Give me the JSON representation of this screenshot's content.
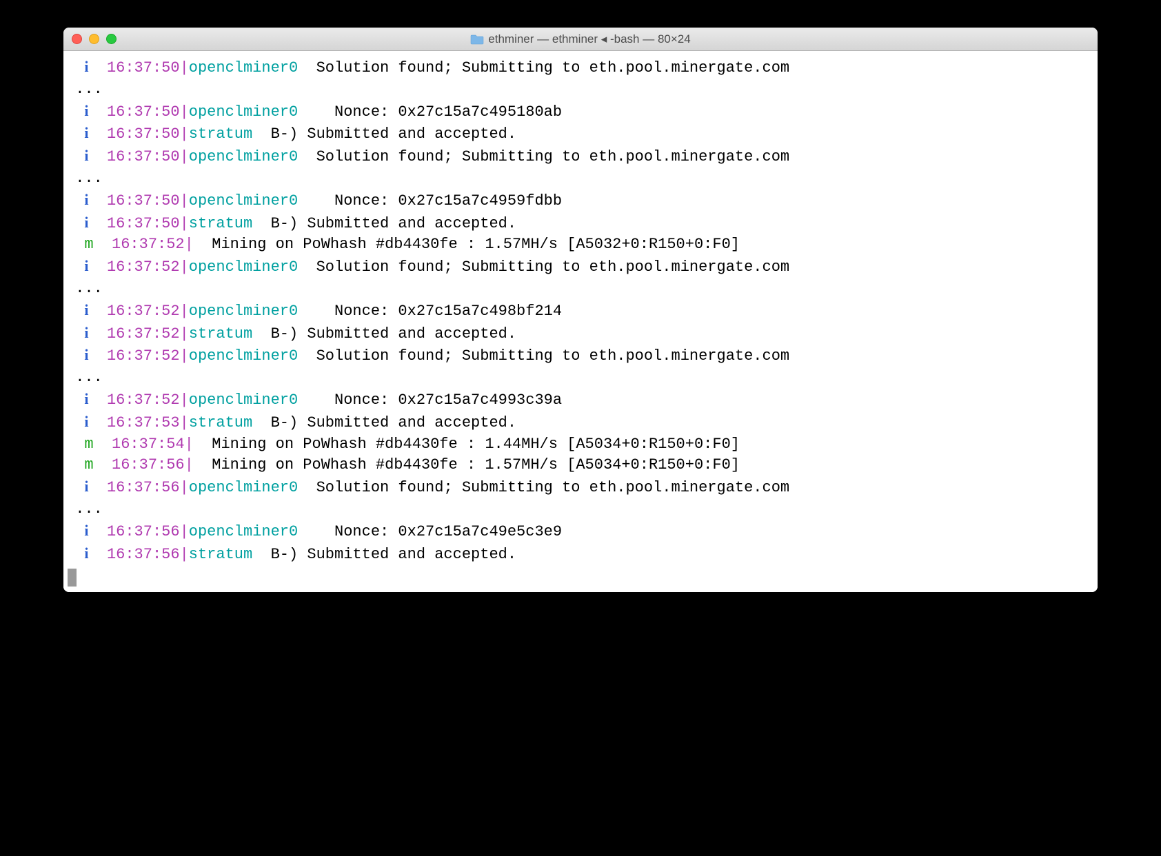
{
  "window": {
    "title": "ethminer — ethminer ◂ -bash — 80×24"
  },
  "colors": {
    "info_level": "#2b5dcd",
    "mining_level": "#1fa61f",
    "timestamp": "#b03ab0",
    "source": "#00a0a0",
    "text": "#000000"
  },
  "lines": [
    {
      "type": "log",
      "level": "i",
      "ts": "16:37:50",
      "src": "openclminer0",
      "msg": "  Solution found; Submitting to eth.pool.minergate.com"
    },
    {
      "type": "ellipsis",
      "text": " ..."
    },
    {
      "type": "log",
      "level": "i",
      "ts": "16:37:50",
      "src": "openclminer0",
      "msg": "    Nonce: 0x27c15a7c495180ab"
    },
    {
      "type": "log",
      "level": "i",
      "ts": "16:37:50",
      "src": "stratum",
      "msg": "  B-) Submitted and accepted."
    },
    {
      "type": "log",
      "level": "i",
      "ts": "16:37:50",
      "src": "openclminer0",
      "msg": "  Solution found; Submitting to eth.pool.minergate.com"
    },
    {
      "type": "ellipsis",
      "text": " ..."
    },
    {
      "type": "log",
      "level": "i",
      "ts": "16:37:50",
      "src": "openclminer0",
      "msg": "    Nonce: 0x27c15a7c4959fdbb"
    },
    {
      "type": "log",
      "level": "i",
      "ts": "16:37:50",
      "src": "stratum",
      "msg": "  B-) Submitted and accepted."
    },
    {
      "type": "log",
      "level": "m",
      "ts": "16:37:52",
      "src": "",
      "msg": "  Mining on PoWhash #db4430fe : 1.57MH/s [A5032+0:R150+0:F0]"
    },
    {
      "type": "log",
      "level": "i",
      "ts": "16:37:52",
      "src": "openclminer0",
      "msg": "  Solution found; Submitting to eth.pool.minergate.com"
    },
    {
      "type": "ellipsis",
      "text": " ..."
    },
    {
      "type": "log",
      "level": "i",
      "ts": "16:37:52",
      "src": "openclminer0",
      "msg": "    Nonce: 0x27c15a7c498bf214"
    },
    {
      "type": "log",
      "level": "i",
      "ts": "16:37:52",
      "src": "stratum",
      "msg": "  B-) Submitted and accepted."
    },
    {
      "type": "log",
      "level": "i",
      "ts": "16:37:52",
      "src": "openclminer0",
      "msg": "  Solution found; Submitting to eth.pool.minergate.com"
    },
    {
      "type": "ellipsis",
      "text": " ..."
    },
    {
      "type": "log",
      "level": "i",
      "ts": "16:37:52",
      "src": "openclminer0",
      "msg": "    Nonce: 0x27c15a7c4993c39a"
    },
    {
      "type": "log",
      "level": "i",
      "ts": "16:37:53",
      "src": "stratum",
      "msg": "  B-) Submitted and accepted."
    },
    {
      "type": "log",
      "level": "m",
      "ts": "16:37:54",
      "src": "",
      "msg": "  Mining on PoWhash #db4430fe : 1.44MH/s [A5034+0:R150+0:F0]"
    },
    {
      "type": "log",
      "level": "m",
      "ts": "16:37:56",
      "src": "",
      "msg": "  Mining on PoWhash #db4430fe : 1.57MH/s [A5034+0:R150+0:F0]"
    },
    {
      "type": "log",
      "level": "i",
      "ts": "16:37:56",
      "src": "openclminer0",
      "msg": "  Solution found; Submitting to eth.pool.minergate.com"
    },
    {
      "type": "ellipsis",
      "text": " ..."
    },
    {
      "type": "log",
      "level": "i",
      "ts": "16:37:56",
      "src": "openclminer0",
      "msg": "    Nonce: 0x27c15a7c49e5c3e9"
    },
    {
      "type": "log",
      "level": "i",
      "ts": "16:37:56",
      "src": "stratum",
      "msg": "  B-) Submitted and accepted."
    }
  ]
}
